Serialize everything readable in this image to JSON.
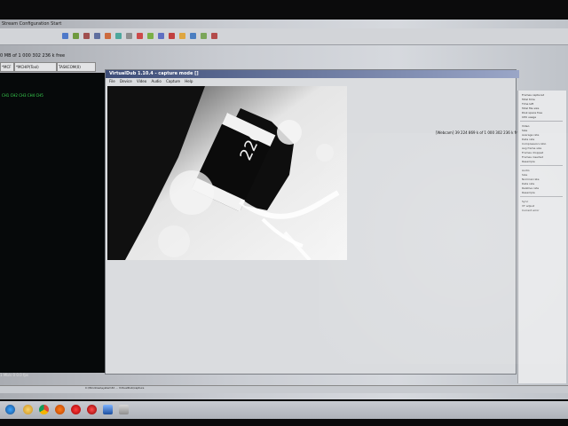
{
  "menu_bar": {
    "text": "Stream  Configuration  Start"
  },
  "status_line": {
    "text": "0 MB of 1 000 302 236 k free"
  },
  "tabs": [
    "*MCF",
    "*MCHIP(Tool)",
    "TASKCOM(0)"
  ],
  "left_green_text": "CH1  CH2  CH3  CH4  CH5",
  "left_bottom_text": "1 Mb/s  0  0.0 fps",
  "virtualdub": {
    "title": "VirtualDub 1.10.4 - capture mode []",
    "menu": [
      "File",
      "Device",
      "Video",
      "Audio",
      "Capture",
      "Help"
    ],
    "info_line": "[Webcam]  39 224 869 k of 1 000 302 236 k free"
  },
  "video_frame": {
    "chip_marking": "220"
  },
  "right_panel": {
    "group1": [
      "Frames captured",
      "Total time",
      "Time left",
      "Total file size",
      "Disk space free",
      "CPU usage"
    ],
    "group2": [
      "Video",
      "Size",
      "Average rate",
      "Data rate",
      "Compression ratio",
      "Avg frame size",
      "Frames dropped",
      "Frames inserted",
      "Resample"
    ],
    "group3": [
      "Audio",
      "Size",
      "Nominal rate",
      "Data rate",
      "Relative rate",
      "Resample"
    ],
    "group4": [
      "Sync",
      "VT adjust",
      "Current error"
    ]
  },
  "bottom_caption": "C:\\Windows\\system32 ... VirtualDub\\capture"
}
